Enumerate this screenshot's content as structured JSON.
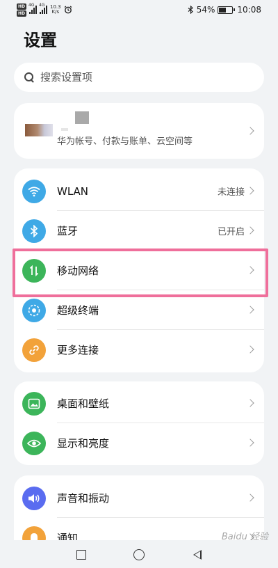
{
  "status_bar": {
    "hd1": "HD",
    "hd2": "HD",
    "sig1_label": "4G",
    "sig2_label": "4G",
    "speed_value": "10.3",
    "speed_unit": "K/s",
    "battery": "54%",
    "battery_level": 0.54,
    "time": "10:08"
  },
  "page_title": "设置",
  "search": {
    "placeholder": "搜索设置项"
  },
  "account": {
    "description": "华为帐号、付款与账单、云空间等"
  },
  "network_items": [
    {
      "label": "WLAN",
      "value": "未连接",
      "icon": "wifi-icon",
      "color": "#3fa9e6"
    },
    {
      "label": "蓝牙",
      "value": "已开启",
      "icon": "bluetooth-icon",
      "color": "#3fa9e6"
    },
    {
      "label": "移动网络",
      "value": "",
      "icon": "mobile-data-icon",
      "color": "#3cb55a"
    },
    {
      "label": "超级终端",
      "value": "",
      "icon": "super-device-icon",
      "color": "#3fa9e6"
    },
    {
      "label": "更多连接",
      "value": "",
      "icon": "link-icon",
      "color": "#f2a23a"
    }
  ],
  "display_items": [
    {
      "label": "桌面和壁纸",
      "icon": "wallpaper-icon",
      "color": "#3cb55a"
    },
    {
      "label": "显示和亮度",
      "icon": "eye-icon",
      "color": "#3cb55a"
    }
  ],
  "sound_items": [
    {
      "label": "声音和振动",
      "icon": "speaker-icon",
      "color": "#5a6cf0"
    },
    {
      "label": "通知",
      "icon": "bell-icon",
      "color": "#f2a23a"
    }
  ],
  "highlight_color": "#ef6f9b",
  "watermark": "Baidu 经验"
}
